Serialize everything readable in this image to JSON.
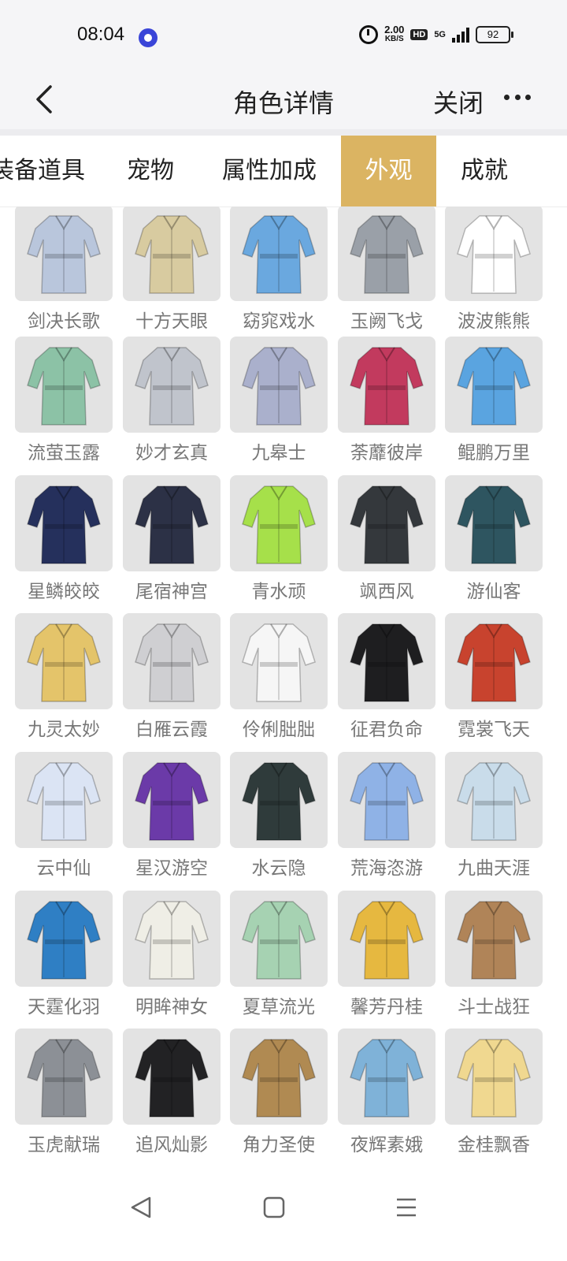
{
  "status_bar": {
    "time": "08:04",
    "net_speed": "2.00",
    "net_unit": "KB/S",
    "hd": "HD",
    "network": "5G",
    "battery": "92"
  },
  "header": {
    "title": "角色详情",
    "close_label": "关闭"
  },
  "tabs": [
    {
      "label": "装备道具",
      "active": false
    },
    {
      "label": "宠物",
      "active": false
    },
    {
      "label": "属性加成",
      "active": false
    },
    {
      "label": "外观",
      "active": true
    },
    {
      "label": "成就",
      "active": false
    }
  ],
  "outfits": [
    {
      "name": "剑决长歌",
      "color": "#b9c6dc"
    },
    {
      "name": "十方天眼",
      "color": "#d8cba0"
    },
    {
      "name": "窈窕戏水",
      "color": "#6aa8df"
    },
    {
      "name": "玉阙飞戈",
      "color": "#9aa0a8"
    },
    {
      "name": "波波熊熊",
      "color": "#ffffff"
    },
    {
      "name": "流萤玉露",
      "color": "#8cc2a6"
    },
    {
      "name": "妙才玄真",
      "color": "#c0c4cc"
    },
    {
      "name": "九皋士",
      "color": "#aab0cc"
    },
    {
      "name": "荼蘼彼岸",
      "color": "#c23a5e"
    },
    {
      "name": "鲲鹏万里",
      "color": "#5aa4e0"
    },
    {
      "name": "星鳞皎皎",
      "color": "#25305c"
    },
    {
      "name": "尾宿神宫",
      "color": "#2c3146"
    },
    {
      "name": "青水顽",
      "color": "#a6e04a"
    },
    {
      "name": "飒西风",
      "color": "#34383c"
    },
    {
      "name": "游仙客",
      "color": "#2e5560"
    },
    {
      "name": "九灵太妙",
      "color": "#e4c46a"
    },
    {
      "name": "白雁云霞",
      "color": "#cfcfd2"
    },
    {
      "name": "伶俐朏朏",
      "color": "#f6f6f6"
    },
    {
      "name": "征君负命",
      "color": "#1e1e20"
    },
    {
      "name": "霓裳飞天",
      "color": "#c8432e"
    },
    {
      "name": "云中仙",
      "color": "#dbe4f4"
    },
    {
      "name": "星汉游空",
      "color": "#6b3aa8"
    },
    {
      "name": "水云隐",
      "color": "#2f3b3b"
    },
    {
      "name": "荒海恣游",
      "color": "#8fb2e6"
    },
    {
      "name": "九曲天涯",
      "color": "#c9dcea"
    },
    {
      "name": "天霆化羽",
      "color": "#2f7fc4"
    },
    {
      "name": "明眸神女",
      "color": "#efeee6"
    },
    {
      "name": "夏草流光",
      "color": "#a6d2b2"
    },
    {
      "name": "馨芳丹桂",
      "color": "#e6b840"
    },
    {
      "name": "斗士战狂",
      "color": "#b08458"
    },
    {
      "name": "玉虎献瑞",
      "color": "#8c9096"
    },
    {
      "name": "追风灿影",
      "color": "#222224"
    },
    {
      "name": "角力圣使",
      "color": "#b08a52"
    },
    {
      "name": "夜辉素娥",
      "color": "#7fb2d8"
    },
    {
      "name": "金桂飘香",
      "color": "#f0d890"
    }
  ],
  "icons": {
    "back": "back-arrow-icon",
    "more": "more-dots-icon",
    "nav_back": "triangle-back-icon",
    "nav_home": "square-home-icon",
    "nav_menu": "menu-lines-icon"
  }
}
